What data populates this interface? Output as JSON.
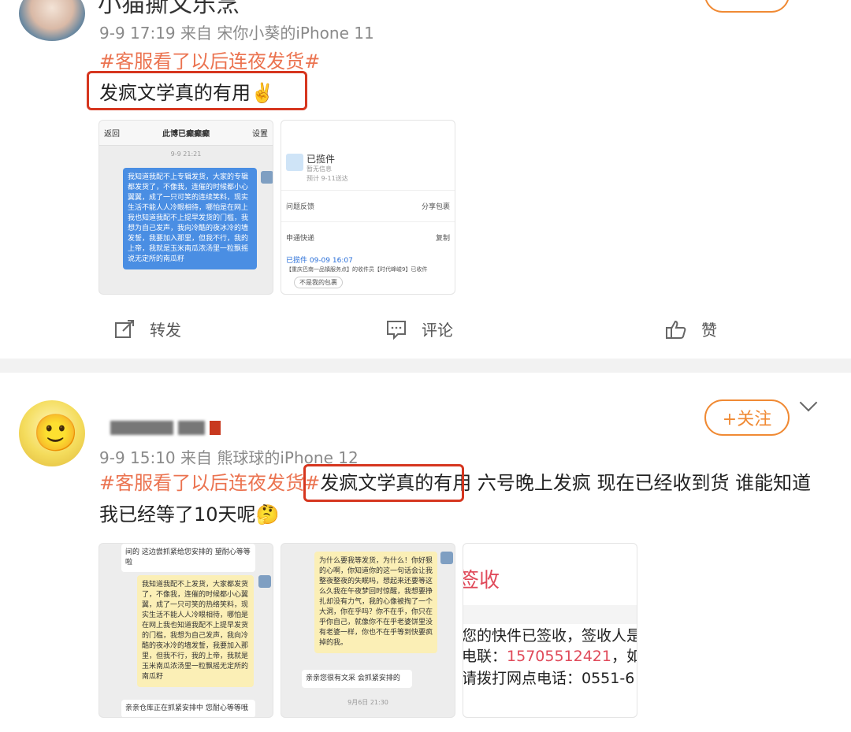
{
  "posts": [
    {
      "username": "小猫撕文乐烹",
      "meta": "9-9 17:19  来自 宋你小葵的iPhone 11",
      "hashtag": "#客服看了以后连夜发货#",
      "highlight": "发疯文学真的有用✌️",
      "images": [
        {
          "type": "chat",
          "header": {
            "back": "返回",
            "title": "此博已癫癫癫",
            "settings": "设置"
          },
          "time": "9-9 21:21",
          "message": "我知道我配不上专辑发货，大家的专辑都发货了，不像我，连催的时候都小心翼翼，成了一只可笑的连续笑料，现实生活不能人人冷眼相待，哪怕是在网上我也知道我配不上提早发货的门槛，我想为自己发声，我向冷酷的夜冰冷的墙发誓，我要加入那里，但我不行，我的上帝，我就是玉米南瓜浓汤里一粒飘摇说无定所的南瓜籽"
        },
        {
          "type": "package",
          "status": "已揽件",
          "status_sub": "暂无信息",
          "eta": "预计 9-11送达",
          "feedback": "问题反馈",
          "share": "分享包裹",
          "courier": "申通快递",
          "copy": "复制",
          "update_title": "已揽件 09-09 16:07",
          "update_body": "【重庆巴南一品镇服务点】的收件员【时代峰峻9】已收件",
          "tag": "不是我的包裹"
        }
      ],
      "actions": {
        "repost": "转发",
        "comment": "评论",
        "like": "赞"
      }
    },
    {
      "username": "",
      "follow": "+关注",
      "meta": "9-9 15:10  来自 熊球球的iPhone 12",
      "hashtag": "#客服看了以后连夜发货#",
      "highlight": "发疯文学真的有用",
      "text_after": " 六号晚上发疯 现在已经收到货 谁能知道我已经等了10天呢",
      "emoji": "🤔",
      "images": [
        {
          "type": "chat",
          "top_text": "间的  这边尝抓紧给您安排的  望耐心等等啦",
          "message": "我知道我配不上发货，大家都发货了，不像我，连催的时候都小心翼翼，成了一只可笑的热络笑料，现实生活不能人人冷眼相待，哪怕是在网上我也知道我配不上提早发货的门槛，我想为自己发声，我向冷酷的夜冰冷的墙发誓，我要加入那里，但我不行，我的上帝，我就是玉米南瓜浓汤里一粒飘摇无定所的南瓜籽",
          "bottom_text": "亲亲仓库正在抓紧安排中  您耐心等等哦"
        },
        {
          "type": "chat",
          "message": "为什么要我等发货，为什么！你好狠的心啊，你知道你的这一句话会让我整夜整夜的失眠吗，想起来还要等这么久我在午夜梦回时惊醒，我想要挣扎却没有力气，我的心像被掏了一个大洞，你在乎吗？你不在乎，你只在乎你自己，就像你不在乎老婆饼里没有老婆一样，你也不在乎等到快要疯掉的我。",
          "reply": "亲亲您很有文采  会抓紧安排的",
          "time": "9月6日 21:30"
        },
        {
          "type": "sms",
          "heading": "签收",
          "line1": "您的快件已签收，签收人是",
          "line2_prefix": "电联：",
          "phone": "15705512421",
          "line2_suffix": "，如有",
          "line3": "请拨打网点电话：0551-6"
        }
      ]
    }
  ]
}
